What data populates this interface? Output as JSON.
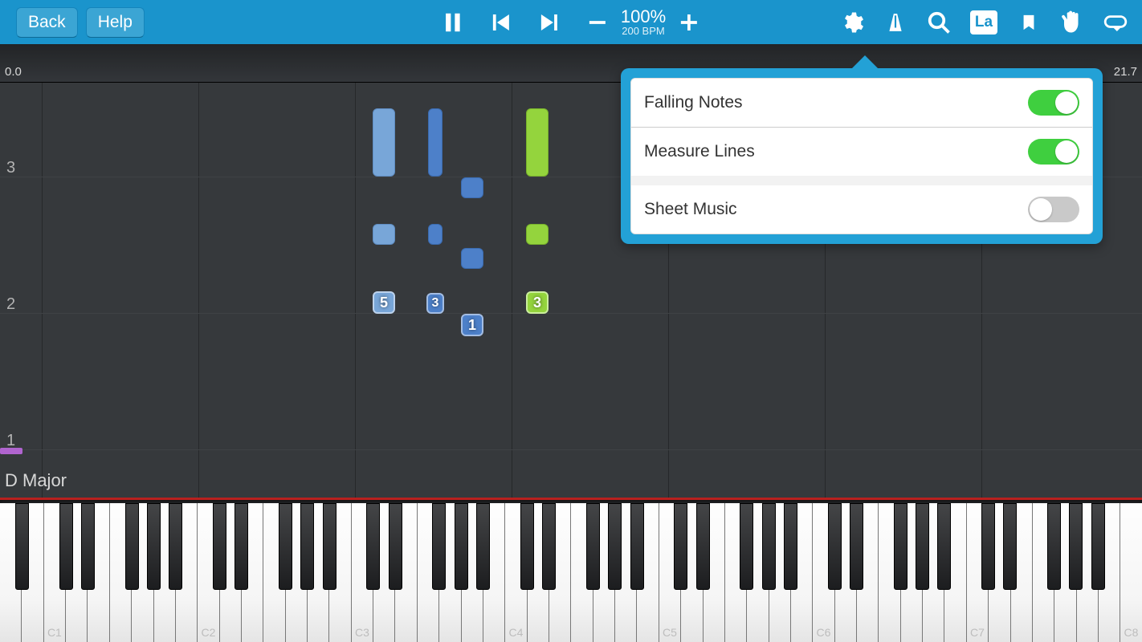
{
  "toolbar": {
    "back": "Back",
    "help": "Help",
    "speed_percent": "100%",
    "speed_bpm": "200 BPM"
  },
  "right_icons": {
    "la_label": "La"
  },
  "notefall": {
    "time_left": "0.0",
    "time_right": "21.7",
    "measure3": "3",
    "measure2": "2",
    "measure1": "1",
    "key": "D Major",
    "finger5": "5",
    "finger3s": "3",
    "finger1": "1",
    "finger3g": "3"
  },
  "popover": {
    "row1": "Falling Notes",
    "row2": "Measure Lines",
    "row3": "Sheet Music",
    "state1": true,
    "state2": true,
    "state3": false
  },
  "keyboard": {
    "c1": "C1",
    "c2": "C2",
    "c3": "C3",
    "c4": "C4",
    "c5": "C5",
    "c6": "C6",
    "c7": "C7",
    "c8": "C8"
  }
}
